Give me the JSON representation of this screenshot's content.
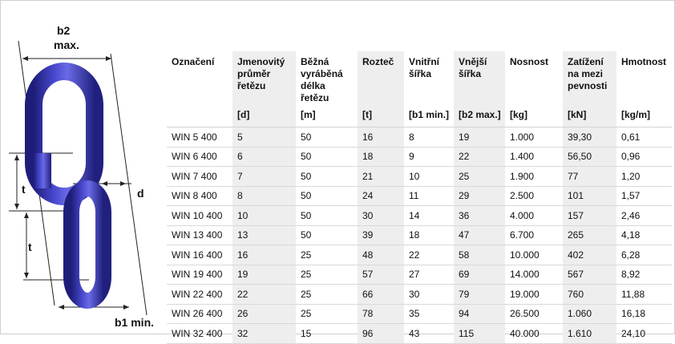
{
  "diagram": {
    "b2_label": "b2",
    "b2_max_label": "max.",
    "t_upper_label": "t",
    "t_lower_label": "t",
    "d_label": "d",
    "b1_min_label": "b1 min.",
    "link_color": "#3a3ab8"
  },
  "table": {
    "shaded_color": "#eeeeee",
    "headers": [
      {
        "label": "Označení",
        "unit": ""
      },
      {
        "label": "Jmenovitý průměr řetězu",
        "unit": "[d]"
      },
      {
        "label": "Běžná vyráběná délka řetězu",
        "unit": "[m]"
      },
      {
        "label": "Rozteč",
        "unit": "[t]"
      },
      {
        "label": "Vnitřní šířka",
        "unit": "[b1 min.]"
      },
      {
        "label": "Vnější šířka",
        "unit": "[b2 max.]"
      },
      {
        "label": "Nosnost",
        "unit": "[kg]"
      },
      {
        "label": "Zatížení na mezi pevnosti",
        "unit": "[kN]"
      },
      {
        "label": "Hmotnost",
        "unit": "[kg/m]"
      }
    ],
    "rows": [
      [
        "WIN 5 400",
        "5",
        "50",
        "16",
        "8",
        "19",
        "1.000",
        "39,30",
        "0,61"
      ],
      [
        "WIN 6 400",
        "6",
        "50",
        "18",
        "9",
        "22",
        "1.400",
        "56,50",
        "0,96"
      ],
      [
        "WIN 7 400",
        "7",
        "50",
        "21",
        "10",
        "25",
        "1.900",
        "77",
        "1,20"
      ],
      [
        "WIN 8 400",
        "8",
        "50",
        "24",
        "11",
        "29",
        "2.500",
        "101",
        "1,57"
      ],
      [
        "WIN 10 400",
        "10",
        "50",
        "30",
        "14",
        "36",
        "4.000",
        "157",
        "2,46"
      ],
      [
        "WIN 13 400",
        "13",
        "50",
        "39",
        "18",
        "47",
        "6.700",
        "265",
        "4,18"
      ],
      [
        "WIN 16 400",
        "16",
        "25",
        "48",
        "22",
        "58",
        "10.000",
        "402",
        "6,28"
      ],
      [
        "WIN 19 400",
        "19",
        "25",
        "57",
        "27",
        "69",
        "14.000",
        "567",
        "8,92"
      ],
      [
        "WIN 22 400",
        "22",
        "25",
        "66",
        "30",
        "79",
        "19.000",
        "760",
        "11,88"
      ],
      [
        "WIN 26 400",
        "26",
        "25",
        "78",
        "35",
        "94",
        "26.500",
        "1.060",
        "16,18"
      ],
      [
        "WIN 32 400",
        "32",
        "15",
        "96",
        "43",
        "115",
        "40.000",
        "1.610",
        "24,10"
      ]
    ]
  }
}
